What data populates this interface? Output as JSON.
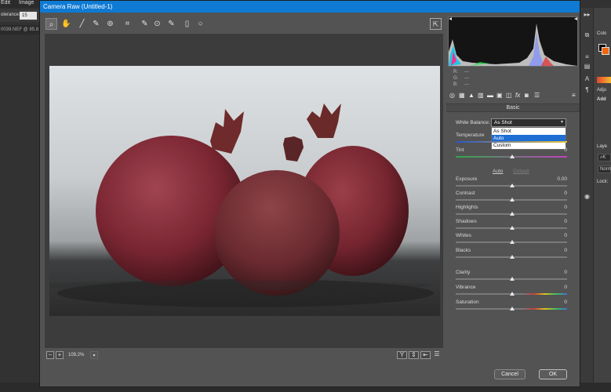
{
  "photoshop": {
    "menu": [
      "Edit",
      "Image"
    ],
    "tolerance_label": "olerance:",
    "tolerance_value": "15",
    "doc_tab": "0039.NEF @ 85.8",
    "right_labels": {
      "color": "Colo",
      "adjust": "Adju",
      "add": "Add",
      "layers": "Laye",
      "kind": "K",
      "normal": "Norm",
      "lock": "Lock:"
    }
  },
  "dialog": {
    "title": "Camera Raw (Untitled-1)",
    "zoom_level": "109.2%",
    "histogram": {
      "r_label": "R:",
      "g_label": "G:",
      "b_label": "B:",
      "r": "---",
      "g": "---",
      "b": "---"
    },
    "section_title": "Basic",
    "white_balance": {
      "label": "White Balance:",
      "value": "As Shot",
      "options": [
        "As Shot",
        "Auto",
        "Custom"
      ],
      "selected_option": "Auto"
    },
    "sliders_top": [
      {
        "label": "Temperature",
        "value": ""
      },
      {
        "label": "Tint",
        "value": "0"
      }
    ],
    "auto_label": "Auto",
    "default_label": "Default",
    "sliders": [
      {
        "label": "Exposure",
        "value": "0.00"
      },
      {
        "label": "Contrast",
        "value": "0"
      },
      {
        "label": "Highlights",
        "value": "0"
      },
      {
        "label": "Shadows",
        "value": "0"
      },
      {
        "label": "Whites",
        "value": "0"
      },
      {
        "label": "Blacks",
        "value": "0"
      }
    ],
    "sliders_presence": [
      {
        "label": "Clarity",
        "value": "0"
      },
      {
        "label": "Vibrance",
        "value": "0"
      },
      {
        "label": "Saturation",
        "value": "0"
      }
    ],
    "cancel_label": "Cancel",
    "ok_label": "OK"
  },
  "colors": {
    "titlebar": "#0e7ad4",
    "selection": "#1f6ed4",
    "fruit": "#7a2632",
    "background_swatch": "#f0660f"
  }
}
